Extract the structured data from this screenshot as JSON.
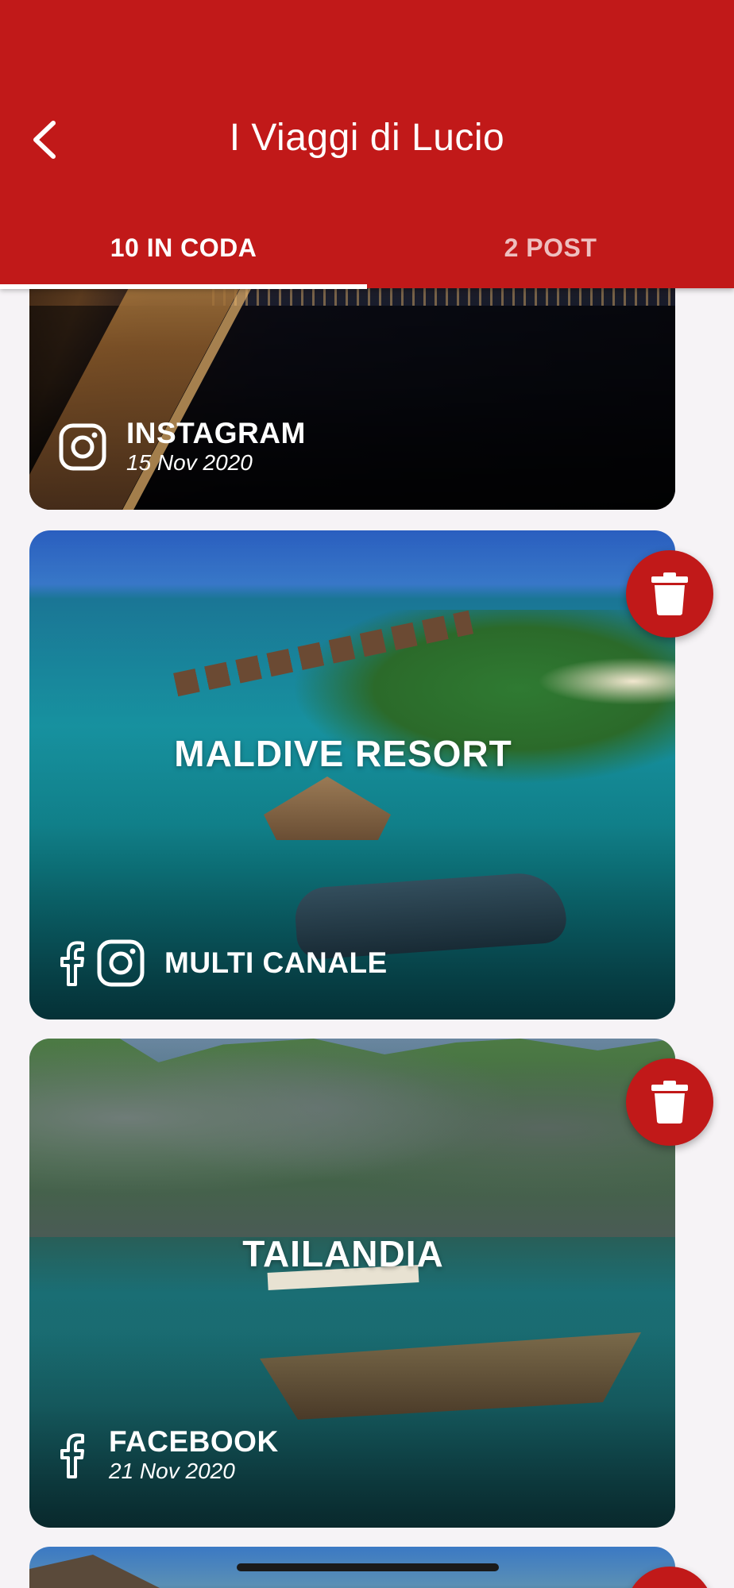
{
  "header": {
    "title": "I Viaggi di Lucio",
    "back_icon": "chevron-left-icon",
    "tabs": [
      {
        "label": "10 IN CODA",
        "active": true
      },
      {
        "label": "2 POST",
        "active": false
      }
    ]
  },
  "posts": [
    {
      "title": "",
      "channels": [
        "instagram"
      ],
      "channel_label": "INSTAGRAM",
      "date": "15 Nov 2020"
    },
    {
      "title": "MALDIVE RESORT",
      "channels": [
        "facebook",
        "instagram"
      ],
      "channel_label": "MULTI CANALE",
      "date": ""
    },
    {
      "title": "TAILANDIA",
      "channels": [
        "facebook"
      ],
      "channel_label": "FACEBOOK",
      "date": "21 Nov 2020"
    }
  ],
  "colors": {
    "primary": "#c11919",
    "background": "#f6f3f6",
    "text_on_primary": "#ffffff"
  },
  "icons": {
    "delete": "trash-icon",
    "instagram": "instagram-icon",
    "facebook": "facebook-icon"
  }
}
